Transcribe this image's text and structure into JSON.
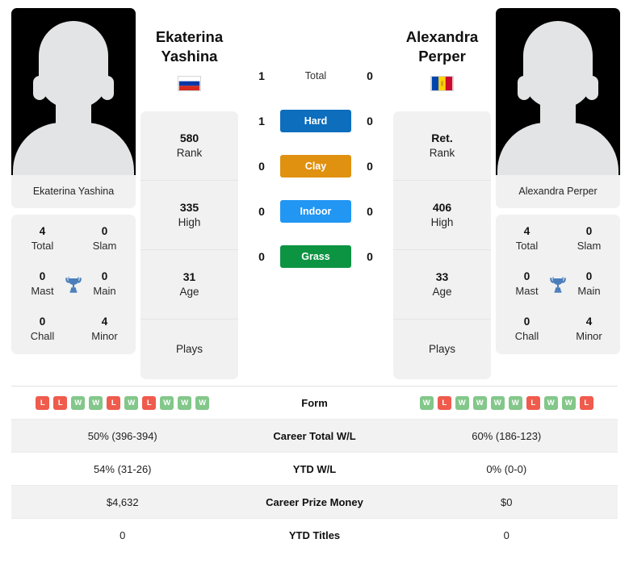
{
  "players": {
    "left": {
      "first_name": "Ekaterina",
      "last_name": "Yashina",
      "full_name": "Ekaterina Yashina",
      "photo_caption": "Ekaterina Yashina",
      "flag": "russia-flag",
      "rank": "580",
      "rank_label": "Rank",
      "high": "335",
      "high_label": "High",
      "age": "31",
      "age_label": "Age",
      "plays": "",
      "plays_label": "Plays",
      "titles": {
        "total": "4",
        "total_label": "Total",
        "slam": "0",
        "slam_label": "Slam",
        "mast": "0",
        "mast_label": "Mast",
        "main": "0",
        "main_label": "Main",
        "chall": "0",
        "chall_label": "Chall",
        "minor": "4",
        "minor_label": "Minor"
      },
      "form": [
        "L",
        "L",
        "W",
        "W",
        "L",
        "W",
        "L",
        "W",
        "W",
        "W"
      ],
      "career_total_wl": "50% (396-394)",
      "ytd_wl": "54% (31-26)",
      "career_prize_money": "$4,632",
      "ytd_titles": "0"
    },
    "right": {
      "first_name": "Alexandra",
      "last_name": "Perper",
      "full_name": "Alexandra Perper",
      "photo_caption": "Alexandra Perper",
      "flag": "moldova-flag",
      "rank": "Ret.",
      "rank_label": "Rank",
      "high": "406",
      "high_label": "High",
      "age": "33",
      "age_label": "Age",
      "plays": "",
      "plays_label": "Plays",
      "titles": {
        "total": "4",
        "total_label": "Total",
        "slam": "0",
        "slam_label": "Slam",
        "mast": "0",
        "mast_label": "Mast",
        "main": "0",
        "main_label": "Main",
        "chall": "0",
        "chall_label": "Chall",
        "minor": "4",
        "minor_label": "Minor"
      },
      "form": [
        "W",
        "L",
        "W",
        "W",
        "W",
        "W",
        "L",
        "W",
        "W",
        "L"
      ],
      "career_total_wl": "60% (186-123)",
      "ytd_wl": "0% (0-0)",
      "career_prize_money": "$0",
      "ytd_titles": "0"
    }
  },
  "h2h": {
    "rows": [
      {
        "label": "Total",
        "left": "1",
        "right": "0",
        "pill": false,
        "color": ""
      },
      {
        "label": "Hard",
        "left": "1",
        "right": "0",
        "pill": true,
        "color": "#0d6ebd"
      },
      {
        "label": "Clay",
        "left": "0",
        "right": "0",
        "pill": true,
        "color": "#e09110"
      },
      {
        "label": "Indoor",
        "left": "0",
        "right": "0",
        "pill": true,
        "color": "#2196f3"
      },
      {
        "label": "Grass",
        "left": "0",
        "right": "0",
        "pill": true,
        "color": "#0d9442"
      }
    ]
  },
  "table": {
    "rows": [
      {
        "label": "Form",
        "type": "form"
      },
      {
        "label": "Career Total W/L",
        "type": "text",
        "key": "career_total_wl"
      },
      {
        "label": "YTD W/L",
        "type": "text",
        "key": "ytd_wl"
      },
      {
        "label": "Career Prize Money",
        "type": "text",
        "key": "career_prize_money"
      },
      {
        "label": "YTD Titles",
        "type": "text",
        "key": "ytd_titles"
      }
    ]
  },
  "colors": {
    "win_badge": "#83c78a",
    "loss_badge": "#ef5b4c",
    "card_bg": "#f1f1f1",
    "trophy": "#4a7ebb"
  }
}
